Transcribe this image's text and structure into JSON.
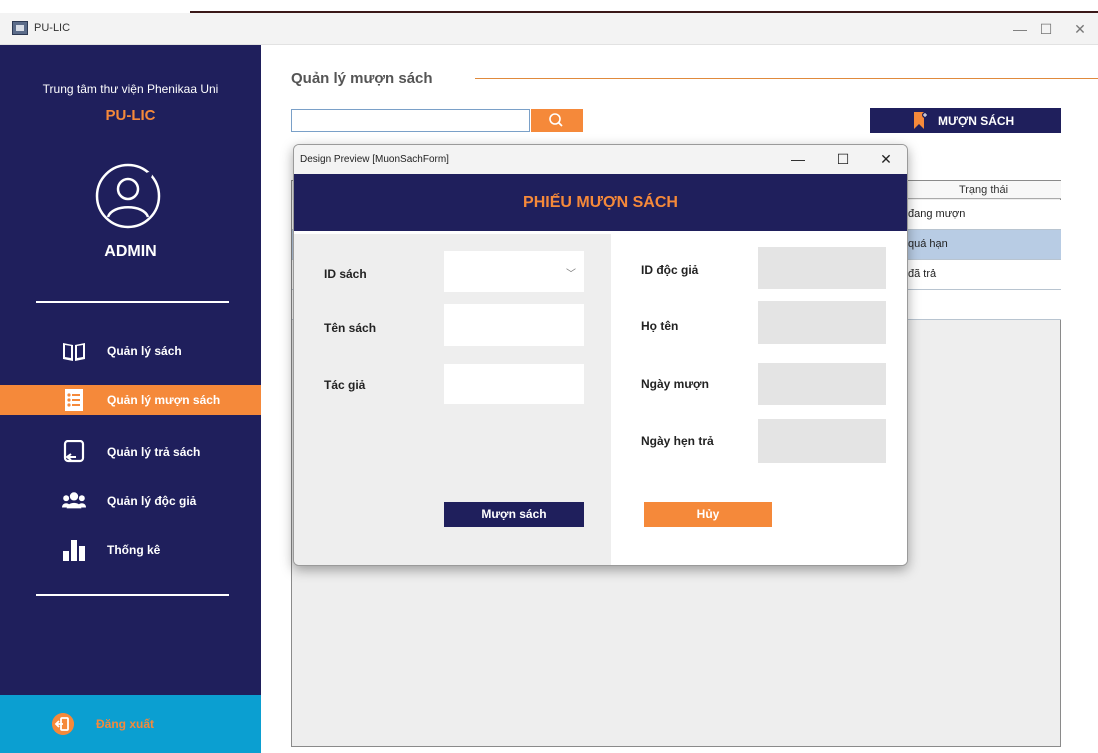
{
  "window": {
    "title": "PU-LIC",
    "min_glyph": "—",
    "max_glyph": "☐",
    "close_glyph": "✕"
  },
  "sidebar": {
    "subtitle": "Trung tâm thư viện Phenikaa Uni",
    "brand": "PU-LIC",
    "user": "ADMIN",
    "items": [
      {
        "label": "Quản lý sách",
        "icon": "book-icon",
        "active": false
      },
      {
        "label": "Quản lý mượn sách",
        "icon": "checklist-icon",
        "active": true
      },
      {
        "label": "Quản lý trả sách",
        "icon": "return-icon",
        "active": false
      },
      {
        "label": "Quản lý độc giả",
        "icon": "users-icon",
        "active": false
      },
      {
        "label": "Thống kê",
        "icon": "bar-chart-icon",
        "active": false
      }
    ],
    "logout": "Đăng xuất"
  },
  "main": {
    "title": "Quản lý mượn sách",
    "search": {
      "value": "",
      "placeholder": ""
    },
    "borrow_button": "MƯỢN SÁCH",
    "table": {
      "header": "Trạng thái",
      "rows": [
        {
          "status": "đang mượn",
          "selected": false
        },
        {
          "status": "quá hạn",
          "selected": true
        },
        {
          "status": "đã trả",
          "selected": false
        },
        {
          "status": "",
          "selected": false
        }
      ]
    }
  },
  "dialog": {
    "title": "Design Preview [MuonSachForm]",
    "min_glyph": "—",
    "max_glyph": "☐",
    "close_glyph": "✕",
    "heading": "PHIẾU MƯỢN SÁCH",
    "left_fields": [
      {
        "label": "ID sách",
        "value": ""
      },
      {
        "label": "Tên sách",
        "value": ""
      },
      {
        "label": "Tác giả",
        "value": ""
      }
    ],
    "right_fields": [
      {
        "label": "ID độc giả",
        "value": ""
      },
      {
        "label": "Họ tên",
        "value": ""
      },
      {
        "label": "Ngày mượn",
        "value": ""
      },
      {
        "label": "Ngày hẹn trả",
        "value": ""
      }
    ],
    "confirm_button": "Mượn sách",
    "cancel_button": "Hủy",
    "combo_arrow": "﹀"
  },
  "colors": {
    "navy": "#1f1f5c",
    "orange": "#f5893a",
    "logout_blue": "#0b9fd1",
    "selected_row": "#b8cce4"
  }
}
